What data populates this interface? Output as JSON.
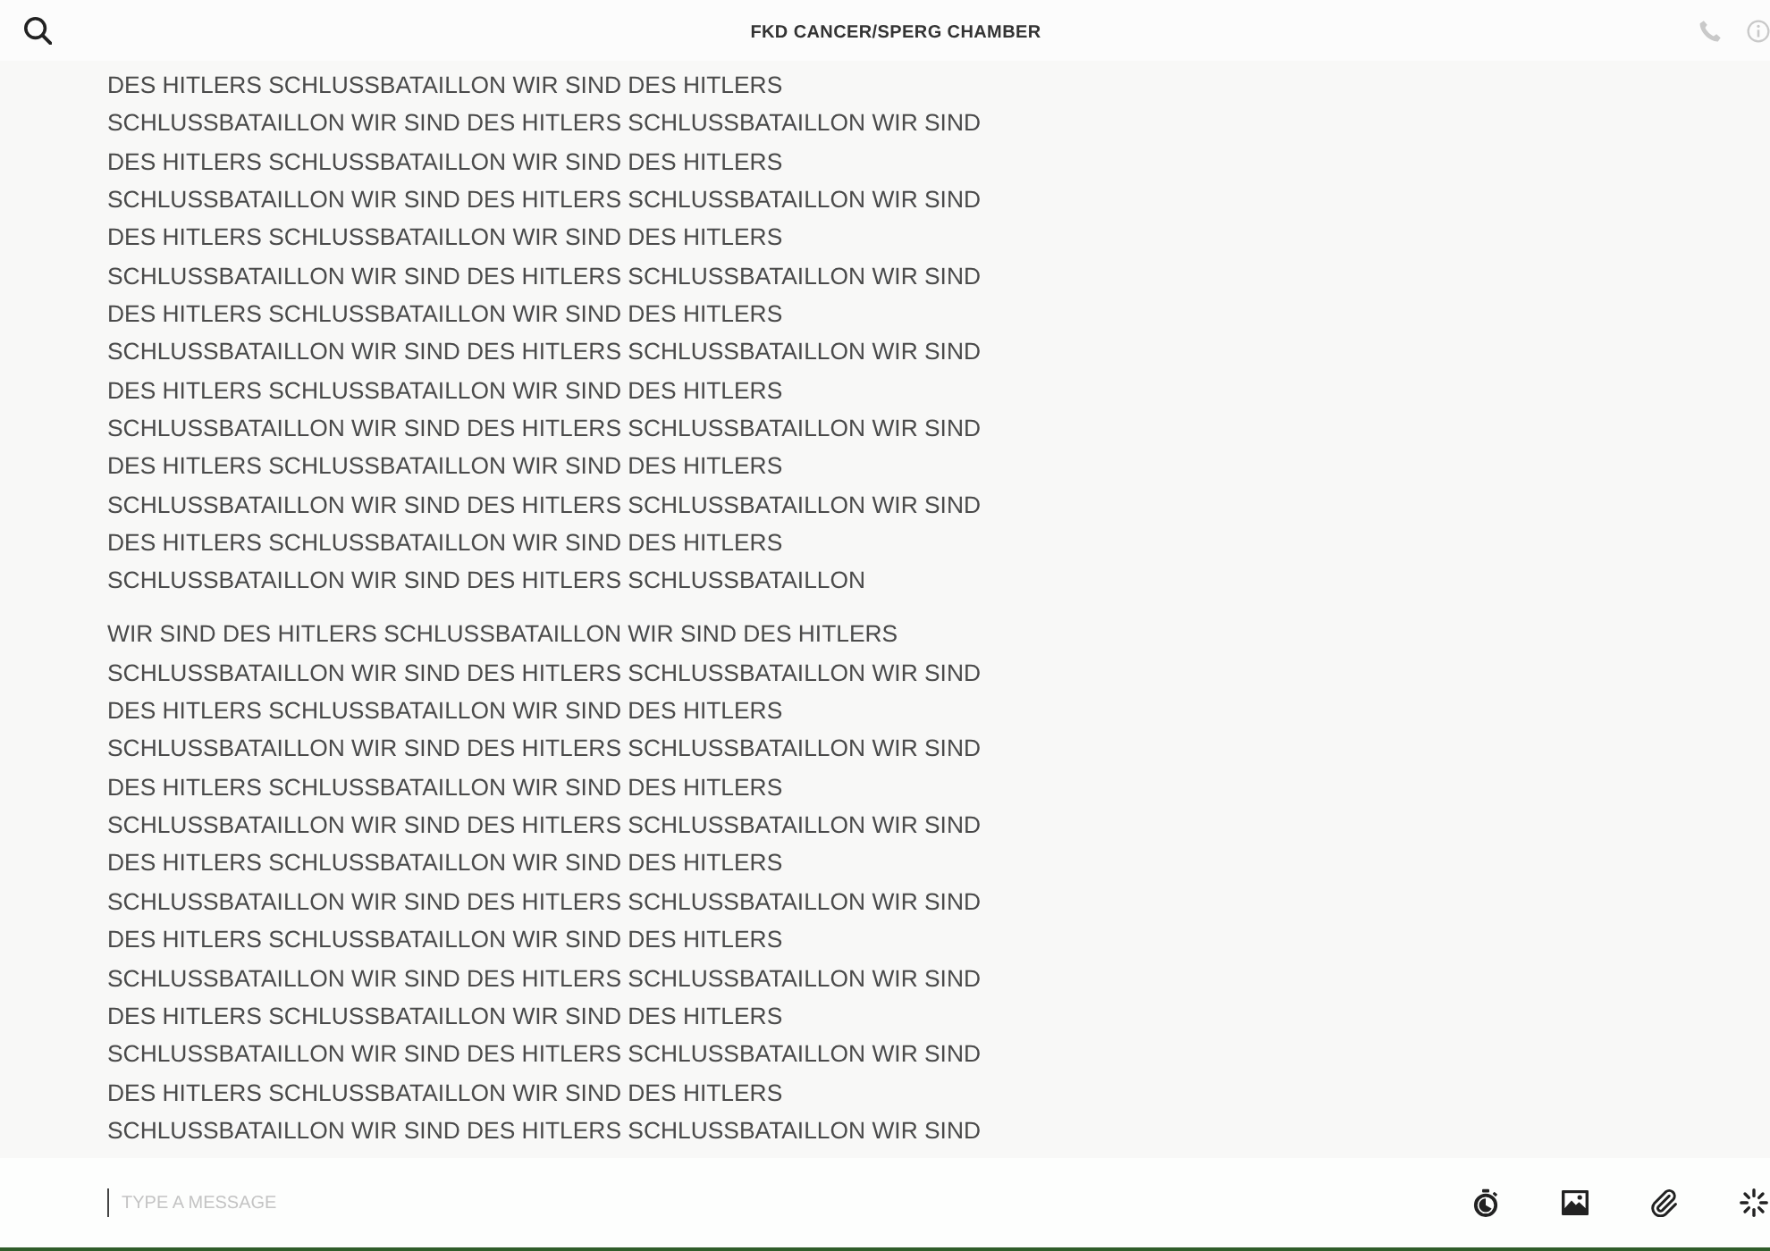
{
  "header": {
    "title": "FKD CANCER/SPERG CHAMBER"
  },
  "messages": [
    {
      "text": "DES HITLERS SCHLUSSBATAILLON WIR SIND DES HITLERS SCHLUSSBATAILLON WIR SIND DES HITLERS SCHLUSSBATAILLON WIR SIND DES HITLERS SCHLUSSBATAILLON WIR SIND DES HITLERS SCHLUSSBATAILLON WIR SIND DES HITLERS SCHLUSSBATAILLON WIR SIND DES HITLERS SCHLUSSBATAILLON WIR SIND DES HITLERS SCHLUSSBATAILLON WIR SIND DES HITLERS SCHLUSSBATAILLON WIR SIND DES HITLERS SCHLUSSBATAILLON WIR SIND DES HITLERS SCHLUSSBATAILLON WIR SIND DES HITLERS SCHLUSSBATAILLON WIR SIND DES HITLERS SCHLUSSBATAILLON WIR SIND DES HITLERS SCHLUSSBATAILLON WIR SIND DES HITLERS SCHLUSSBATAILLON WIR SIND DES HITLERS SCHLUSSBATAILLON WIR SIND DES HITLERS SCHLUSSBATAILLON WIR SIND DES HITLERS SCHLUSSBATAILLON WIR SIND DES HITLERS SCHLUSSBATAILLON WIR SIND DES HITLERS SCHLUSSBATAILLON WIR SIND DES HITLERS SCHLUSSBATAILLON"
    },
    {
      "text": "WIR SIND DES HITLERS SCHLUSSBATAILLON WIR SIND DES HITLERS SCHLUSSBATAILLON WIR SIND DES HITLERS SCHLUSSBATAILLON WIR SIND DES HITLERS SCHLUSSBATAILLON WIR SIND DES HITLERS SCHLUSSBATAILLON WIR SIND DES HITLERS SCHLUSSBATAILLON WIR SIND DES HITLERS SCHLUSSBATAILLON WIR SIND DES HITLERS SCHLUSSBATAILLON WIR SIND DES HITLERS SCHLUSSBATAILLON WIR SIND DES HITLERS SCHLUSSBATAILLON WIR SIND DES HITLERS SCHLUSSBATAILLON WIR SIND DES HITLERS SCHLUSSBATAILLON WIR SIND DES HITLERS SCHLUSSBATAILLON WIR SIND DES HITLERS SCHLUSSBATAILLON WIR SIND DES HITLERS SCHLUSSBATAILLON WIR SIND DES HITLERS SCHLUSSBATAILLON WIR SIND DES HITLERS SCHLUSSBATAILLON WIR SIND DES HITLERS SCHLUSSBATAILLON WIR SIND DES HITLERS SCHLUSSBATAILLON WIR SIND DES HITLERS SCHLUSSBATAILLON WIR SIND DES HITLERS SCHLUSSBATAILLON WIR SIND"
    }
  ],
  "composer": {
    "placeholder": "TYPE A MESSAGE"
  }
}
